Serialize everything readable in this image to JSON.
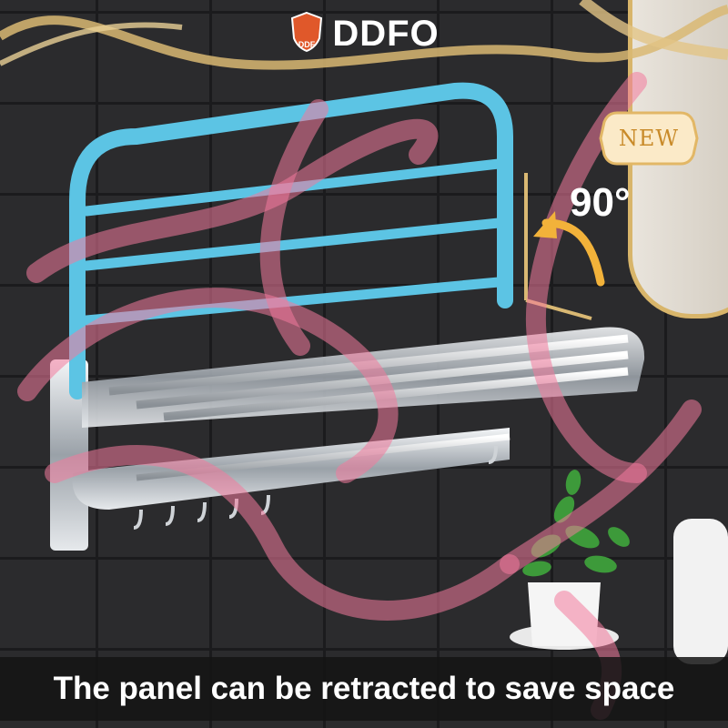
{
  "brand": {
    "logo_text": "DDF",
    "name": "DDFO"
  },
  "badge": {
    "label": "NEW"
  },
  "rotation": {
    "label": "90°"
  },
  "caption": {
    "text": "The panel can be retracted to save space"
  },
  "colors": {
    "panel_frame": "#5cc4e4",
    "chrome": "#d9dde2",
    "ribbon": "#f27a9c",
    "arrow": "#f2b23a",
    "gold_trim": "#d8b56a",
    "brand_logo": "#e0582a"
  },
  "icons": {
    "rotation_arrow": "curved-arrow-left-icon",
    "brand_logo": "shield-logo-icon"
  }
}
